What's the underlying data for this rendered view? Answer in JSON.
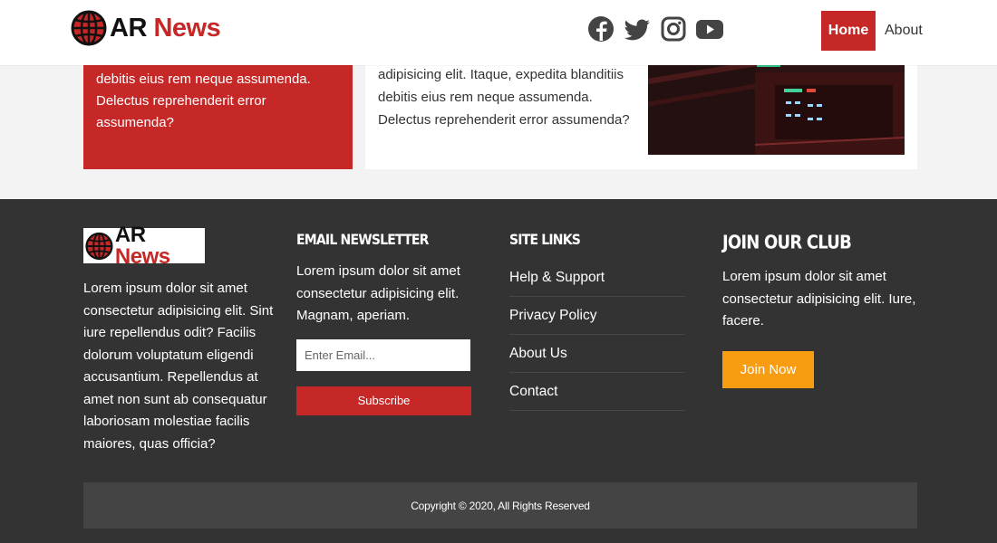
{
  "header": {
    "logo_ar": "AR",
    "logo_news": "News",
    "social_icons": [
      "facebook-icon",
      "twitter-icon",
      "instagram-icon",
      "youtube-icon"
    ],
    "nav": {
      "home": "Home",
      "about": "About"
    }
  },
  "cards": {
    "red_text": "debitis eius rem neque assumenda. Delectus reprehenderit error assumenda?",
    "white_text": "adipisicing elit. Itaque, expedita blanditiis debitis eius rem neque assumenda. Delectus reprehenderit error assumenda?"
  },
  "footer": {
    "about": {
      "logo_ar": "AR",
      "logo_news": "News",
      "text": "Lorem ipsum dolor sit amet consectetur adipisicing elit. Sint iure repellendus odit? Facilis dolorum voluptatum eligendi accusantium. Repellendus at amet non sunt ab consequatur laboriosam molestiae facilis maiores, quas officia?"
    },
    "newsletter": {
      "title": "Email Newsletter",
      "text": "Lorem ipsum dolor sit amet consectetur adipisicing elit. Magnam, aperiam.",
      "placeholder": "Enter Email...",
      "button": "Subscribe"
    },
    "links": {
      "title": "Site Links",
      "items": [
        "Help & Support",
        "Privacy Policy",
        "About Us",
        "Contact"
      ]
    },
    "club": {
      "title": "Join Our Club",
      "text": "Lorem ipsum dolor sit amet consectetur adipisicing elit. Iure, facere.",
      "button": "Join Now"
    },
    "copyright": "Copyright © 2020, All Rights Reserved"
  },
  "colors": {
    "brand_red": "#c62828",
    "footer_bg": "#333333",
    "accent_orange": "#f89c12"
  }
}
